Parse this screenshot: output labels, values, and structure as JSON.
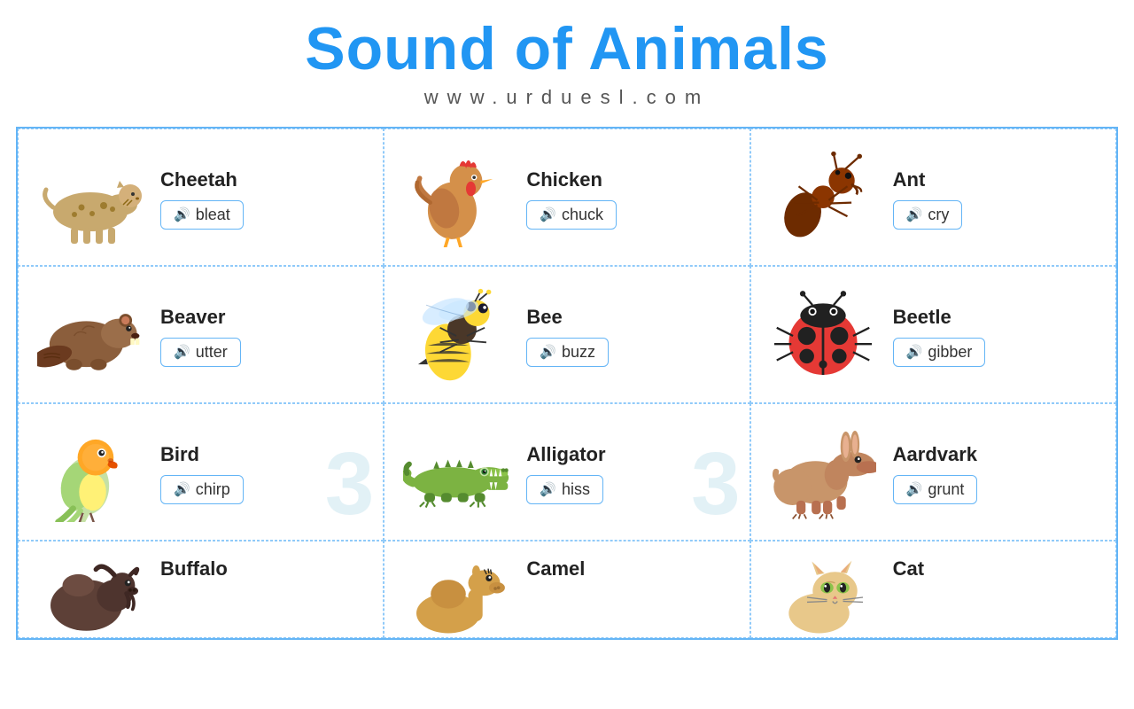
{
  "header": {
    "title": "Sound of Animals",
    "subtitle": "www.urduesl.com"
  },
  "animals": [
    {
      "id": 1,
      "name": "Cheetah",
      "sound": "bleat",
      "emoji": "🐆",
      "row": 1,
      "col": 1
    },
    {
      "id": 2,
      "name": "Chicken",
      "sound": "chuck",
      "emoji": "🐔",
      "row": 1,
      "col": 2
    },
    {
      "id": 3,
      "name": "Ant",
      "sound": "cry",
      "emoji": "🐜",
      "row": 1,
      "col": 3
    },
    {
      "id": 4,
      "name": "Beaver",
      "sound": "utter",
      "emoji": "🦫",
      "row": 2,
      "col": 1
    },
    {
      "id": 5,
      "name": "Bee",
      "sound": "buzz",
      "emoji": "🐝",
      "row": 2,
      "col": 2
    },
    {
      "id": 6,
      "name": "Beetle",
      "sound": "gibber",
      "emoji": "🐞",
      "row": 2,
      "col": 3
    },
    {
      "id": 7,
      "name": "Bird",
      "sound": "chirp",
      "emoji": "🦜",
      "row": 3,
      "col": 1
    },
    {
      "id": 8,
      "name": "Alligator",
      "sound": "hiss",
      "emoji": "🐊",
      "row": 3,
      "col": 2
    },
    {
      "id": 9,
      "name": "Aardvark",
      "sound": "grunt",
      "emoji": "🐾",
      "row": 3,
      "col": 3
    },
    {
      "id": 10,
      "name": "Buffalo",
      "sound": "",
      "emoji": "🦬",
      "row": 4,
      "col": 1
    },
    {
      "id": 11,
      "name": "Camel",
      "sound": "",
      "emoji": "🐪",
      "row": 4,
      "col": 2
    },
    {
      "id": 12,
      "name": "Cat",
      "sound": "",
      "emoji": "🐱",
      "row": 4,
      "col": 3
    }
  ],
  "sound_button_label": "🔊",
  "watermark_numbers": [
    "",
    "",
    "",
    "",
    "",
    "",
    "3",
    "3",
    "",
    "",
    "",
    ""
  ]
}
